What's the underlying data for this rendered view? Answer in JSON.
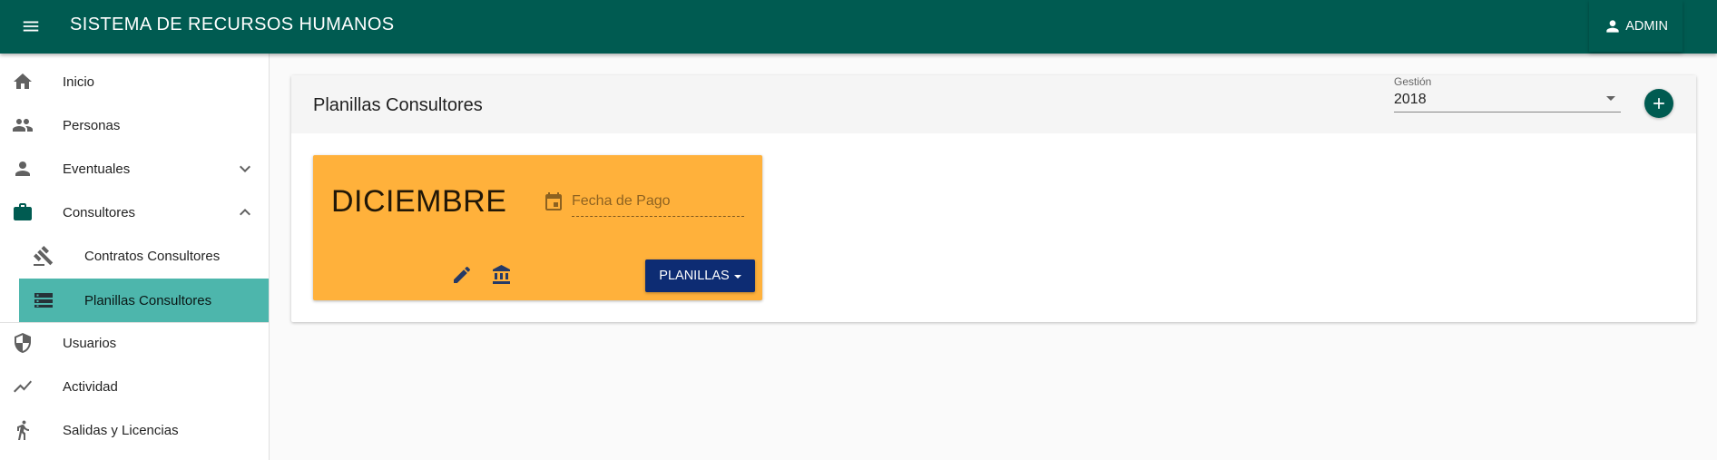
{
  "topbar": {
    "title": "SISTEMA DE RECURSOS HUMANOS",
    "user_label": "ADMIN",
    "background": "#005b51"
  },
  "sidebar": {
    "items": [
      {
        "label": "Inicio",
        "icon": "home-icon"
      },
      {
        "label": "Personas",
        "icon": "people-icon"
      },
      {
        "label": "Eventuales",
        "icon": "person-icon",
        "expanded": false
      },
      {
        "label": "Consultores",
        "icon": "briefcase-icon",
        "expanded": true
      },
      {
        "label": "Contratos Consultores",
        "icon": "gavel-icon"
      },
      {
        "label": "Planillas Consultores",
        "icon": "list-icon",
        "active": true
      },
      {
        "label": "Usuarios",
        "icon": "shield-icon"
      },
      {
        "label": "Actividad",
        "icon": "trending-icon"
      },
      {
        "label": "Salidas y Licencias",
        "icon": "walk-icon"
      }
    ],
    "active_color": "#4db6ac"
  },
  "panel": {
    "title": "Planillas Consultores",
    "gestion_label": "Gestión",
    "gestion_value": "2018"
  },
  "card": {
    "month": "DICIEMBRE",
    "date_placeholder": "Fecha de Pago",
    "button_label": "PLANILLAS",
    "background": "#ffb13b",
    "button_color": "#0d2c73"
  }
}
